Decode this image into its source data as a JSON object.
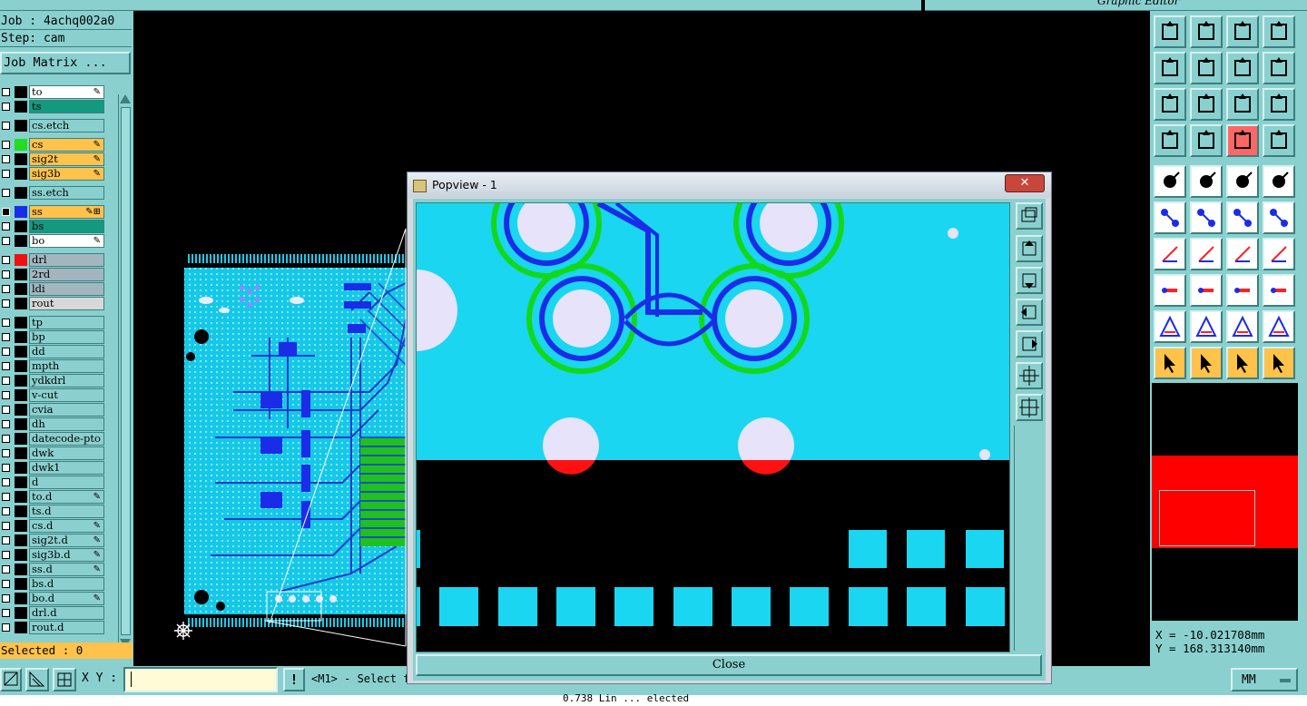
{
  "window": {
    "job_line": "Job : 4achq002a0",
    "step_line": "Step: cam",
    "top_right_title": "Graphic Editor"
  },
  "left_panel": {
    "job_matrix_button": "Job Matrix ...",
    "selected_label": "Selected : 0",
    "layers": [
      {
        "name": "to",
        "color": "#ffffff",
        "swatch": "#000000",
        "mark": "✎"
      },
      {
        "name": "ts",
        "color": "#129a7e",
        "swatch": "#000000",
        "mark": ""
      },
      {
        "name": "cs.etch",
        "color": "#8ad0cf",
        "swatch": "#000000",
        "mark": ""
      },
      {
        "name": "cs",
        "color": "#ffc24a",
        "swatch": "#22dd22",
        "mark": "✎"
      },
      {
        "name": "sig2t",
        "color": "#ffc24a",
        "swatch": "#000000",
        "mark": "✎"
      },
      {
        "name": "sig3b",
        "color": "#ffc24a",
        "swatch": "#000000",
        "mark": "✎"
      },
      {
        "name": "ss.etch",
        "color": "#8ad0cf",
        "swatch": "#000000",
        "mark": ""
      },
      {
        "name": "ss",
        "color": "#ffc24a",
        "swatch": "#1b2ce8",
        "mark": "✎⊞"
      },
      {
        "name": "bs",
        "color": "#129a7e",
        "swatch": "#000000",
        "mark": ""
      },
      {
        "name": "bo",
        "color": "#ffffff",
        "swatch": "#000000",
        "mark": "✎"
      },
      {
        "name": "drl",
        "color": "#a3b6c0",
        "swatch": "#ee1111",
        "mark": ""
      },
      {
        "name": "2rd",
        "color": "#a3b6c0",
        "swatch": "#000000",
        "mark": ""
      },
      {
        "name": "ldi",
        "color": "#a3b6c0",
        "swatch": "#000000",
        "mark": ""
      },
      {
        "name": "rout",
        "color": "#d8d8d8",
        "swatch": "#000000",
        "mark": ""
      },
      {
        "name": "tp",
        "color": "#8ad0cf",
        "swatch": "#000000",
        "mark": ""
      },
      {
        "name": "bp",
        "color": "#8ad0cf",
        "swatch": "#000000",
        "mark": ""
      },
      {
        "name": "dd",
        "color": "#8ad0cf",
        "swatch": "#000000",
        "mark": ""
      },
      {
        "name": "mpth",
        "color": "#8ad0cf",
        "swatch": "#000000",
        "mark": ""
      },
      {
        "name": "ydkdrl",
        "color": "#8ad0cf",
        "swatch": "#000000",
        "mark": ""
      },
      {
        "name": "v-cut",
        "color": "#8ad0cf",
        "swatch": "#000000",
        "mark": ""
      },
      {
        "name": "cvia",
        "color": "#8ad0cf",
        "swatch": "#000000",
        "mark": ""
      },
      {
        "name": "dh",
        "color": "#8ad0cf",
        "swatch": "#000000",
        "mark": ""
      },
      {
        "name": "datecode-pto",
        "color": "#8ad0cf",
        "swatch": "#000000",
        "mark": ""
      },
      {
        "name": "dwk",
        "color": "#8ad0cf",
        "swatch": "#000000",
        "mark": ""
      },
      {
        "name": "dwk1",
        "color": "#8ad0cf",
        "swatch": "#000000",
        "mark": ""
      },
      {
        "name": "d",
        "color": "#8ad0cf",
        "swatch": "#000000",
        "mark": ""
      },
      {
        "name": "to.d",
        "color": "#8ad0cf",
        "swatch": "#000000",
        "mark": "✎"
      },
      {
        "name": "ts.d",
        "color": "#8ad0cf",
        "swatch": "#000000",
        "mark": ""
      },
      {
        "name": "cs.d",
        "color": "#8ad0cf",
        "swatch": "#000000",
        "mark": "✎"
      },
      {
        "name": "sig2t.d",
        "color": "#8ad0cf",
        "swatch": "#000000",
        "mark": "✎"
      },
      {
        "name": "sig3b.d",
        "color": "#8ad0cf",
        "swatch": "#000000",
        "mark": "✎"
      },
      {
        "name": "ss.d",
        "color": "#8ad0cf",
        "swatch": "#000000",
        "mark": "✎"
      },
      {
        "name": "bs.d",
        "color": "#8ad0cf",
        "swatch": "#000000",
        "mark": ""
      },
      {
        "name": "bo.d",
        "color": "#8ad0cf",
        "swatch": "#000000",
        "mark": "✎"
      },
      {
        "name": "drl.d",
        "color": "#8ad0cf",
        "swatch": "#000000",
        "mark": ""
      },
      {
        "name": "rout.d",
        "color": "#8ad0cf",
        "swatch": "#000000",
        "mark": ""
      }
    ]
  },
  "popview": {
    "title": "Popview - 1",
    "close_label": "Close",
    "close_x": "✕"
  },
  "coords": {
    "x_line": "X = -10.021708mm",
    "y_line": "Y = 168.313140mm"
  },
  "bottom_bar": {
    "xy_label": "X Y :",
    "xy_value": "",
    "exclaim": "!",
    "prompt": "<M1> - Select f",
    "units": "MM"
  },
  "status_line": "0.738 Lin    ...   elected"
}
